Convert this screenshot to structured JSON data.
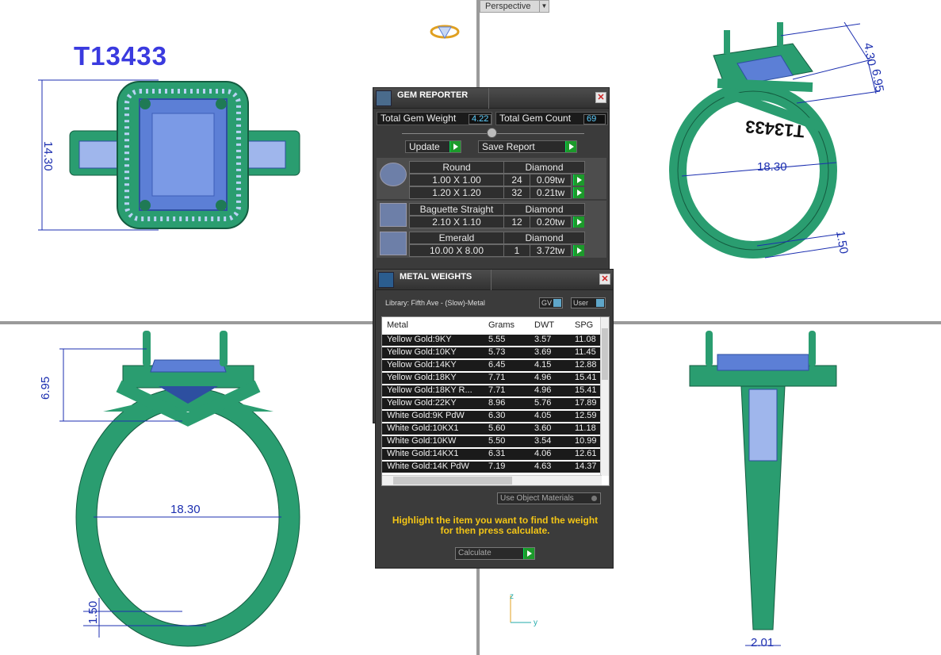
{
  "viewport": {
    "label": "Perspective"
  },
  "design_id": "T13433",
  "dimensions": {
    "tl_height": "14.30",
    "tr_top": "4.30",
    "tr_side": "6.95",
    "tr_inner": "18.30",
    "tr_bottom": "1.50",
    "bl_height": "6.95",
    "bl_inner": "18.30",
    "bl_bottom": "1.50",
    "br_bottom": "2.01",
    "engraving": "T13433"
  },
  "axes": {
    "z": "z",
    "y": "y"
  },
  "gem_reporter": {
    "title": "GEM REPORTER",
    "total_weight_label": "Total Gem Weight",
    "total_weight_value": "4.22",
    "total_count_label": "Total Gem Count",
    "total_count_value": "69",
    "update_label": "Update",
    "save_label": "Save Report",
    "groups": [
      {
        "shape": "Round",
        "material": "Diamond",
        "rows": [
          {
            "size": "1.00 X 1.00",
            "count": "24",
            "tw": "0.09tw"
          },
          {
            "size": "1.20 X 1.20",
            "count": "32",
            "tw": "0.21tw"
          }
        ]
      },
      {
        "shape": "Baguette Straight",
        "material": "Diamond",
        "rows": [
          {
            "size": "2.10 X 1.10",
            "count": "12",
            "tw": "0.20tw"
          }
        ]
      },
      {
        "shape": "Emerald",
        "material": "Diamond",
        "rows": [
          {
            "size": "10.00 X 8.00",
            "count": "1",
            "tw": "3.72tw"
          }
        ]
      }
    ]
  },
  "metal_weights": {
    "title": "METAL WEIGHTS",
    "library": "Library: Fifth Ave - (Slow)-Metal",
    "gv_label": "GV",
    "user_label": "User",
    "columns": [
      "Metal",
      "Grams",
      "DWT",
      "SPG"
    ],
    "rows": [
      {
        "metal": "Yellow Gold:9KY",
        "grams": "5.55",
        "dwt": "3.57",
        "spg": "11.08"
      },
      {
        "metal": "Yellow Gold:10KY",
        "grams": "5.73",
        "dwt": "3.69",
        "spg": "11.45"
      },
      {
        "metal": "Yellow Gold:14KY",
        "grams": "6.45",
        "dwt": "4.15",
        "spg": "12.88"
      },
      {
        "metal": "Yellow Gold:18KY",
        "grams": "7.71",
        "dwt": "4.96",
        "spg": "15.41"
      },
      {
        "metal": "Yellow Gold:18KY R...",
        "grams": "7.71",
        "dwt": "4.96",
        "spg": "15.41"
      },
      {
        "metal": "Yellow Gold:22KY",
        "grams": "8.96",
        "dwt": "5.76",
        "spg": "17.89"
      },
      {
        "metal": "White Gold:9K PdW",
        "grams": "6.30",
        "dwt": "4.05",
        "spg": "12.59"
      },
      {
        "metal": "White Gold:10KX1",
        "grams": "5.60",
        "dwt": "3.60",
        "spg": "11.18"
      },
      {
        "metal": "White Gold:10KW",
        "grams": "5.50",
        "dwt": "3.54",
        "spg": "10.99"
      },
      {
        "metal": "White Gold:14KX1",
        "grams": "6.31",
        "dwt": "4.06",
        "spg": "12.61"
      },
      {
        "metal": "White Gold:14K PdW",
        "grams": "7.19",
        "dwt": "4.63",
        "spg": "14.37"
      }
    ],
    "use_object_label": "Use Object Materials",
    "hint_line1": "Highlight the item you want to find the weight",
    "hint_line2": "for then press calculate.",
    "calculate_label": "Calculate"
  },
  "colors": {
    "metal": "#2a9d70",
    "gem": "#5c7fd6",
    "dimension": "#1c2fb0"
  }
}
